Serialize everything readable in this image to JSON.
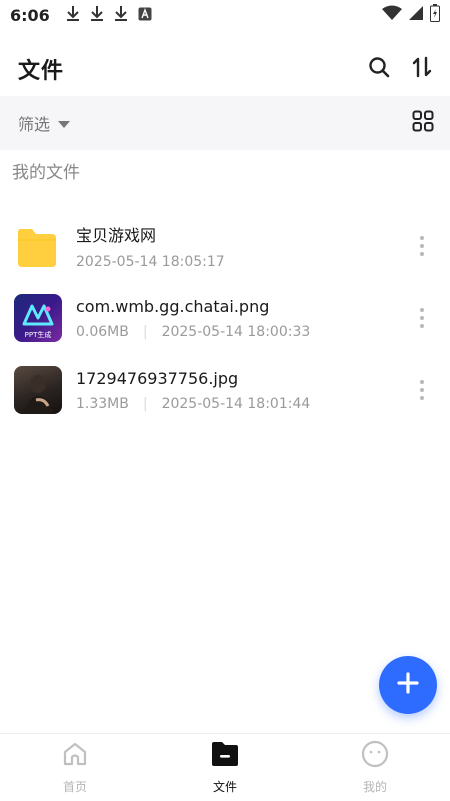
{
  "status_bar": {
    "time": "6:06"
  },
  "header": {
    "title": "文件"
  },
  "filter": {
    "label": "筛选"
  },
  "section": {
    "title": "我的文件"
  },
  "files": [
    {
      "name": "宝贝游戏网",
      "size": "",
      "date": "2025-05-14 18:05:17",
      "kind": "folder"
    },
    {
      "name": "com.wmb.gg.chatai.png",
      "size": "0.06MB",
      "date": "2025-05-14 18:00:33",
      "kind": "image",
      "thumb_text": "PPT生成"
    },
    {
      "name": "1729476937756.jpg",
      "size": "1.33MB",
      "date": "2025-05-14 18:01:44",
      "kind": "photo"
    }
  ],
  "bottom_nav": [
    {
      "label": "首页"
    },
    {
      "label": "文件"
    },
    {
      "label": "我的"
    }
  ],
  "colors": {
    "accent": "#2e6cff",
    "folder": "#ffcf3f"
  },
  "icons": [
    "download-icon",
    "a-icon",
    "wifi-icon",
    "signal-icon",
    "battery-icon",
    "search-icon",
    "sort-icon",
    "grid-view-icon",
    "caret-down-icon",
    "more-vert-icon",
    "plus-icon",
    "home-icon",
    "folder-icon",
    "profile-icon"
  ]
}
